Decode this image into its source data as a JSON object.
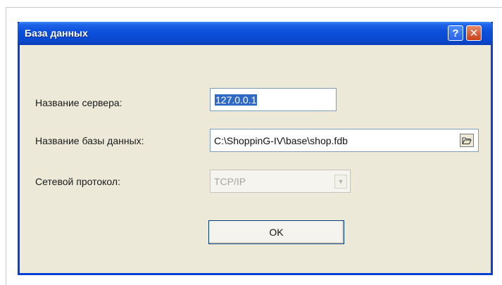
{
  "window": {
    "title": "База данных",
    "help_label": "?",
    "close_label": "✕"
  },
  "form": {
    "server_label": "Название сервера:",
    "server_value": "127.0.0.1",
    "db_label": "Название базы данных:",
    "db_value": "C:\\ShoppinG-IV\\base\\shop.fdb",
    "protocol_label": "Сетевой протокол:",
    "protocol_value": "TCP/IP",
    "protocol_disabled": true
  },
  "buttons": {
    "ok_label": "OK"
  },
  "icons": {
    "browse": "folder-open-icon",
    "dropdown": "chevron-down-icon"
  },
  "colors": {
    "title_bar": "#0a48cf",
    "dialog_bg": "#ece9d8",
    "selection": "#316ac5",
    "close_button": "#c8401b"
  }
}
